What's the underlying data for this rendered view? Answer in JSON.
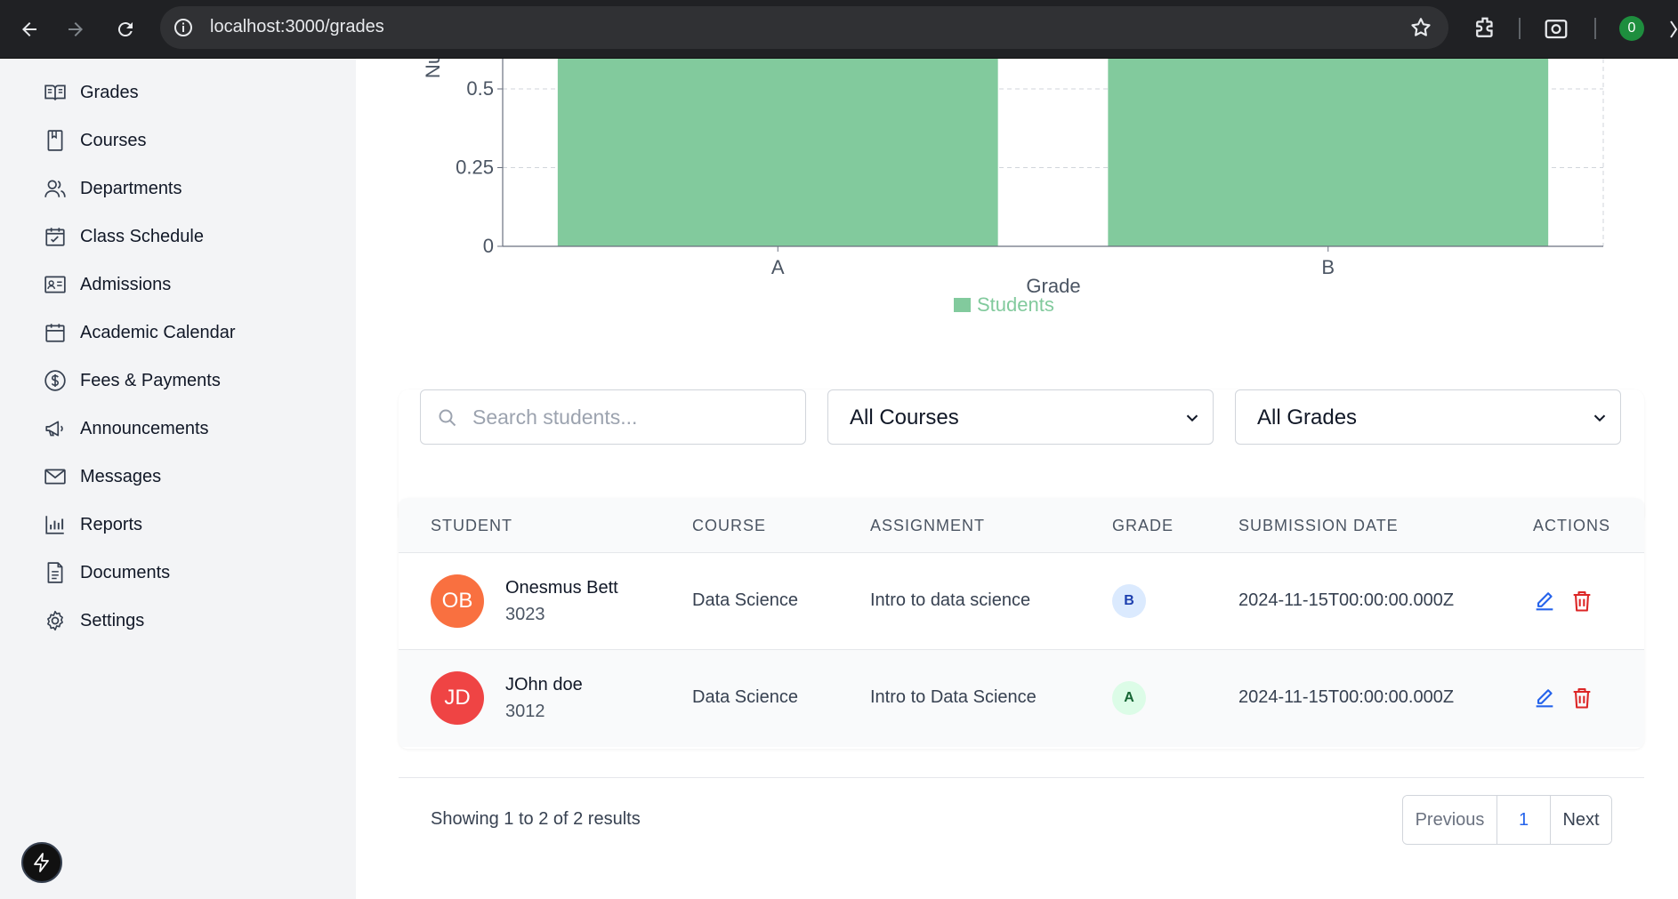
{
  "browser": {
    "url": "localhost:3000/grades",
    "profile_initial": "0"
  },
  "sidebar": {
    "items": [
      {
        "label": "Grades",
        "icon": "book-open-icon"
      },
      {
        "label": "Courses",
        "icon": "book-icon"
      },
      {
        "label": "Departments",
        "icon": "users-icon"
      },
      {
        "label": "Class Schedule",
        "icon": "calendar-check-icon"
      },
      {
        "label": "Admissions",
        "icon": "id-card-icon"
      },
      {
        "label": "Academic Calendar",
        "icon": "calendar-icon"
      },
      {
        "label": "Fees & Payments",
        "icon": "dollar-circle-icon"
      },
      {
        "label": "Announcements",
        "icon": "megaphone-icon"
      },
      {
        "label": "Messages",
        "icon": "mail-icon"
      },
      {
        "label": "Reports",
        "icon": "bar-chart-icon"
      },
      {
        "label": "Documents",
        "icon": "file-text-icon"
      },
      {
        "label": "Settings",
        "icon": "gear-icon"
      }
    ]
  },
  "chart_data": {
    "type": "bar",
    "categories": [
      "A",
      "B"
    ],
    "series": [
      {
        "name": "Students",
        "values": [
          1,
          1
        ],
        "color": "#82ca9d"
      }
    ],
    "xlabel": "Grade",
    "ylabel": "Nu",
    "ylim": [
      0,
      1
    ],
    "y_ticks": [
      "0",
      "0.25",
      "0.5"
    ],
    "grid": true,
    "legend": "bottom-center"
  },
  "filters": {
    "search_placeholder": "Search students...",
    "course_select": "All Courses",
    "grade_select": "All Grades"
  },
  "table": {
    "headers": [
      "STUDENT",
      "COURSE",
      "ASSIGNMENT",
      "GRADE",
      "SUBMISSION DATE",
      "ACTIONS"
    ],
    "rows": [
      {
        "initials": "OB",
        "avatar_color": "#f97040",
        "name": "Onesmus Bett",
        "id": "3023",
        "course": "Data Science",
        "assignment": "Intro to data science",
        "grade": "B",
        "grade_bg": "#dbeafe",
        "grade_fg": "#1e40af",
        "date": "2024-11-15T00:00:00.000Z"
      },
      {
        "initials": "JD",
        "avatar_color": "#ef4444",
        "name": "JOhn doe",
        "id": "3012",
        "course": "Data Science",
        "assignment": "Intro to Data Science",
        "grade": "A",
        "grade_bg": "#dcfce7",
        "grade_fg": "#166534",
        "date": "2024-11-15T00:00:00.000Z"
      }
    ]
  },
  "pagination": {
    "summary": "Showing 1 to 2 of 2 results",
    "previous": "Previous",
    "current": "1",
    "next": "Next"
  }
}
